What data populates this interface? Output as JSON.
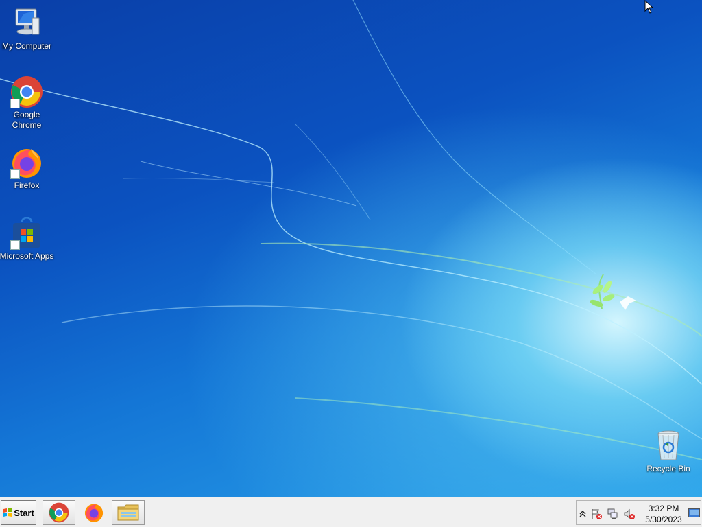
{
  "desktop": {
    "icons": [
      {
        "label": "My Computer",
        "icon": "computer-icon"
      },
      {
        "label": "Google Chrome",
        "icon": "chrome-icon"
      },
      {
        "label": "Firefox",
        "icon": "firefox-icon"
      },
      {
        "label": "Microsoft Apps",
        "icon": "microsoft-store-icon"
      },
      {
        "label": "Recycle Bin",
        "icon": "recycle-bin-icon"
      }
    ]
  },
  "taskbar": {
    "start_label": "Start",
    "pinned": [
      {
        "name": "Google Chrome",
        "icon": "chrome-icon"
      },
      {
        "name": "Firefox",
        "icon": "firefox-icon"
      },
      {
        "name": "File Explorer",
        "icon": "folder-icon"
      }
    ],
    "tray": {
      "icons": [
        "chevron-up-icon",
        "action-center-flag-icon",
        "network-icon",
        "volume-muted-icon"
      ],
      "time": "3:32 PM",
      "date": "5/30/2023"
    }
  },
  "colors": {
    "wallpaper_dark": "#0a3fa8",
    "wallpaper_light": "#2aa3ea",
    "taskbar": "#f0f0f0"
  }
}
